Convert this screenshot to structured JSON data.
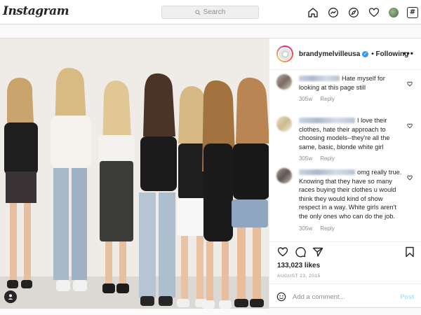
{
  "header": {
    "logo": "Instagram",
    "search_placeholder": "Search"
  },
  "nav_icons": [
    "home-icon",
    "messenger-icon",
    "explore-icon",
    "activity-heart-icon",
    "profile-avatar",
    "hashtag-icon"
  ],
  "hashtag_glyph": "#",
  "post": {
    "username": "brandymelvilleusa",
    "verified_glyph": "✓",
    "follow_status": "• Following",
    "more_glyph": "•••",
    "likes": "133,023 likes",
    "date": "AUGUST 23, 2015",
    "add_comment_placeholder": "Add a comment...",
    "post_label": "Post",
    "comments": [
      {
        "text": "Hate myself for looking at this page still",
        "time": "305w",
        "reply": "Reply"
      },
      {
        "text": "I love their clothes, hate their approach to choosing models--they're all the same, basic, blonde white girl",
        "time": "305w",
        "reply": "Reply"
      },
      {
        "text": "omg really true. Knowing that they have so many races buying their clothes u would think they would kind of show respect in a way. White girls aren't the only ones who can do the job.",
        "time": "305w",
        "reply": "Reply"
      }
    ]
  },
  "colors": {
    "accent_blue": "#3897f0",
    "post_button_disabled": "#b2dffc",
    "border": "#dbdbdb",
    "muted_text": "#8e8e8e"
  }
}
